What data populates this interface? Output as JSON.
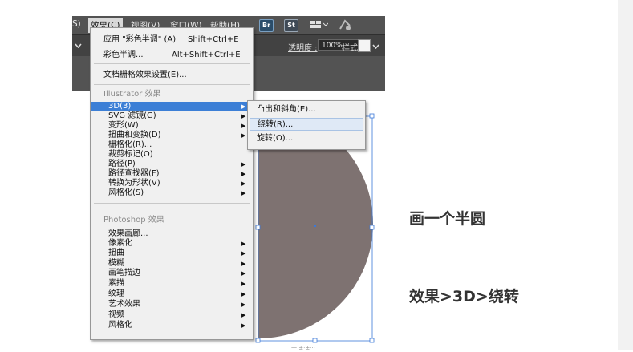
{
  "app": {
    "menubar": {
      "items": [
        {
          "label": "S)",
          "active": false
        },
        {
          "label": "效果(C)",
          "active": true
        },
        {
          "label": "视图(V)",
          "active": false
        },
        {
          "label": "窗口(W)",
          "active": false
        },
        {
          "label": "帮助(H)",
          "active": false
        }
      ],
      "badges": [
        {
          "label": "Br",
          "color": "#2b4d6a"
        },
        {
          "label": "St",
          "color": "#3f4a56"
        }
      ]
    },
    "toolbar": {
      "opacity_label": "透明度 :",
      "opacity_value": "100%",
      "style_label": "样式 :"
    }
  },
  "effects_menu": {
    "top_items": [
      {
        "label": "应用 \"彩色半调\" (A)",
        "shortcut": "Shift+Ctrl+E"
      },
      {
        "label": "彩色半调...",
        "shortcut": "Alt+Shift+Ctrl+E"
      }
    ],
    "doc_item": "文档栅格效果设置(E)...",
    "illustrator_header": "Illustrator 效果",
    "illustrator_items": [
      {
        "label": "3D(3)",
        "submenu": true,
        "highlighted": true
      },
      {
        "label": "SVG 滤镜(G)",
        "submenu": true
      },
      {
        "label": "变形(W)",
        "submenu": true
      },
      {
        "label": "扭曲和变换(D)",
        "submenu": true
      },
      {
        "label": "栅格化(R)...",
        "submenu": false
      },
      {
        "label": "裁剪标记(O)",
        "submenu": false
      },
      {
        "label": "路径(P)",
        "submenu": true
      },
      {
        "label": "路径查找器(F)",
        "submenu": true
      },
      {
        "label": "转换为形状(V)",
        "submenu": true
      },
      {
        "label": "风格化(S)",
        "submenu": true
      }
    ],
    "photoshop_header": "Photoshop 效果",
    "photoshop_items": [
      {
        "label": "效果画廊...",
        "submenu": false
      },
      {
        "label": "像素化",
        "submenu": true
      },
      {
        "label": "扭曲",
        "submenu": true
      },
      {
        "label": "模糊",
        "submenu": true
      },
      {
        "label": "画笔描边",
        "submenu": true
      },
      {
        "label": "素描",
        "submenu": true
      },
      {
        "label": "纹理",
        "submenu": true
      },
      {
        "label": "艺术效果",
        "submenu": true
      },
      {
        "label": "视频",
        "submenu": true
      },
      {
        "label": "风格化",
        "submenu": true
      }
    ]
  },
  "submenu_3d": {
    "items": [
      {
        "label": "凸出和斜角(E)...",
        "highlighted": false
      },
      {
        "label": "绕转(R)...",
        "highlighted": true
      },
      {
        "label": "旋转(O)...",
        "highlighted": false
      }
    ]
  },
  "canvas": {
    "shape": "half-circle",
    "shape_color": "#7e7271",
    "selection_color": "#3b78d8",
    "under_text": "一 ±·±···"
  },
  "captions": {
    "line1": "画一个半圆",
    "line2": "效果>3D>绕转"
  },
  "colors": {
    "app_dark": "#535353",
    "menu_bg": "#f0f0f0",
    "highlight": "#3c7fd6"
  }
}
